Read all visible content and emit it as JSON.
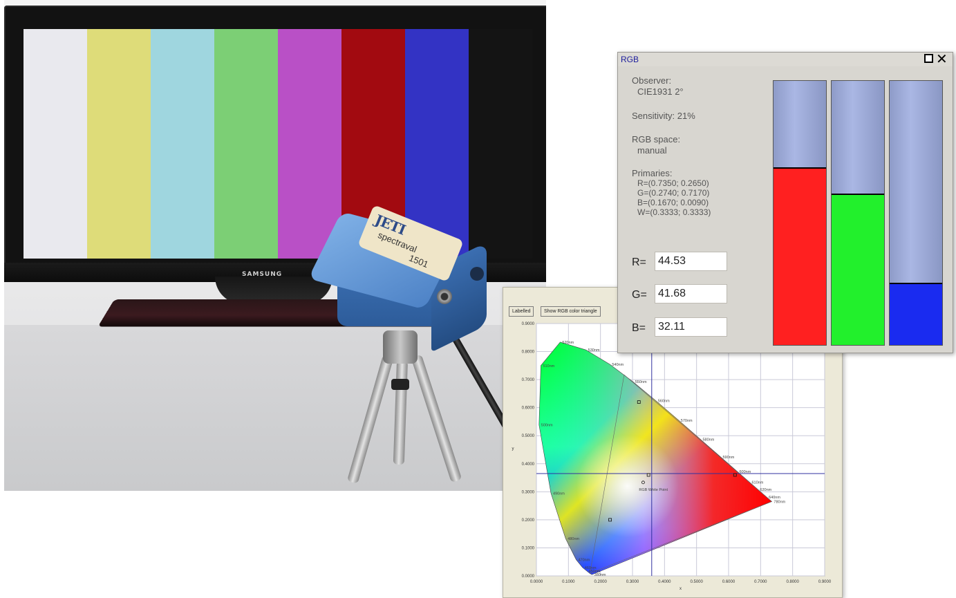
{
  "tv": {
    "brand": "SAMSUNG",
    "color_bars": [
      "#e9e9ee",
      "#dedc79",
      "#9fd6df",
      "#7ccf75",
      "#b950c6",
      "#a20a10",
      "#3333c4",
      "#141414"
    ]
  },
  "device": {
    "logo": "JETI",
    "name": "spectraval",
    "model": "1501"
  },
  "rgb_window": {
    "title": "RGB",
    "observer_label": "Observer:",
    "observer_value": "CIE1931 2°",
    "sensitivity": "Sensitivity: 21%",
    "rgb_space_label": "RGB space:",
    "rgb_space_value": "manual",
    "primaries_label": "Primaries:",
    "primaries": [
      "R=(0.7350; 0.2650)",
      "G=(0.2740; 0.7170)",
      "B=(0.1670; 0.0090)",
      "W=(0.3333; 0.3333)"
    ],
    "r_label": "R=",
    "r_value": "44.53",
    "g_label": "G=",
    "g_value": "41.68",
    "b_label": "B=",
    "b_value": "32.11",
    "levels": {
      "r": 0.6725,
      "g": 0.5725,
      "b": 0.2355
    },
    "colors": {
      "r": "#ff2020",
      "g": "#22f02c",
      "b": "#1a2bf0",
      "empty": "#aab7e4"
    }
  },
  "cie_window": {
    "buttons": [
      "Labelled",
      "Show RGB color triangle"
    ],
    "chart_data": {
      "type": "scatter",
      "xlabel": "x",
      "ylabel": "y",
      "xlim": [
        0,
        0.9
      ],
      "ylim": [
        0,
        0.9
      ],
      "x_ticks": [
        "0.0000",
        "0.1000",
        "0.2000",
        "0.3000",
        "0.4000",
        "0.5000",
        "0.6000",
        "0.7000",
        "0.8000",
        "0.9000"
      ],
      "y_ticks": [
        "0.0000",
        "0.1000",
        "0.2000",
        "0.3000",
        "0.4000",
        "0.5000",
        "0.6000",
        "0.7000",
        "0.8000",
        "0.9000"
      ],
      "grid": true,
      "spectral_locus": [
        [
          0.1741,
          0.005
        ],
        [
          0.173,
          0.0048
        ],
        [
          0.1666,
          0.0089
        ],
        [
          0.144,
          0.0297
        ],
        [
          0.1241,
          0.0578
        ],
        [
          0.0913,
          0.1327
        ],
        [
          0.0454,
          0.295
        ],
        [
          0.0082,
          0.5384
        ],
        [
          0.0139,
          0.7502
        ],
        [
          0.0743,
          0.8338
        ],
        [
          0.1547,
          0.8059
        ],
        [
          0.2296,
          0.7543
        ],
        [
          0.3016,
          0.6923
        ],
        [
          0.3731,
          0.6245
        ],
        [
          0.4441,
          0.5547
        ],
        [
          0.5125,
          0.4866
        ],
        [
          0.5752,
          0.4242
        ],
        [
          0.627,
          0.3725
        ],
        [
          0.6658,
          0.334
        ],
        [
          0.6915,
          0.3083
        ],
        [
          0.7079,
          0.292
        ],
        [
          0.7347,
          0.2653
        ]
      ],
      "wavelength_labels": [
        {
          "text": "520nm",
          "x": 0.0743,
          "y": 0.8338
        },
        {
          "text": "530nm",
          "x": 0.1547,
          "y": 0.8059
        },
        {
          "text": "510nm",
          "x": 0.0139,
          "y": 0.7502
        },
        {
          "text": "540nm",
          "x": 0.2296,
          "y": 0.7543
        },
        {
          "text": "550nm",
          "x": 0.3016,
          "y": 0.6923
        },
        {
          "text": "560nm",
          "x": 0.3731,
          "y": 0.6245
        },
        {
          "text": "500nm",
          "x": 0.0082,
          "y": 0.5384
        },
        {
          "text": "570nm",
          "x": 0.4441,
          "y": 0.5547
        },
        {
          "text": "580nm",
          "x": 0.5125,
          "y": 0.4866
        },
        {
          "text": "590nm",
          "x": 0.5752,
          "y": 0.4242
        },
        {
          "text": "600nm",
          "x": 0.627,
          "y": 0.3725
        },
        {
          "text": "610nm",
          "x": 0.6658,
          "y": 0.334
        },
        {
          "text": "620nm",
          "x": 0.6915,
          "y": 0.3083
        },
        {
          "text": "640nm",
          "x": 0.719,
          "y": 0.2809
        },
        {
          "text": "780nm",
          "x": 0.7347,
          "y": 0.2653
        },
        {
          "text": "490nm",
          "x": 0.0454,
          "y": 0.295
        },
        {
          "text": "480nm",
          "x": 0.0913,
          "y": 0.1327
        },
        {
          "text": "470nm",
          "x": 0.1241,
          "y": 0.0578
        },
        {
          "text": "460nm",
          "x": 0.144,
          "y": 0.0297
        },
        {
          "text": "450nm",
          "x": 0.1566,
          "y": 0.0177
        },
        {
          "text": "380nm",
          "x": 0.1741,
          "y": 0.005
        }
      ],
      "white_point_label": "RGB White Point",
      "primaries_points": [
        [
          0.735,
          0.265
        ],
        [
          0.274,
          0.717
        ],
        [
          0.167,
          0.009
        ],
        [
          0.3333,
          0.3333
        ]
      ],
      "measured_points": [
        [
          0.32,
          0.62
        ],
        [
          0.35,
          0.36
        ],
        [
          0.62,
          0.36
        ],
        [
          0.23,
          0.2
        ]
      ],
      "crosshair": [
        0.36,
        0.365
      ]
    }
  }
}
